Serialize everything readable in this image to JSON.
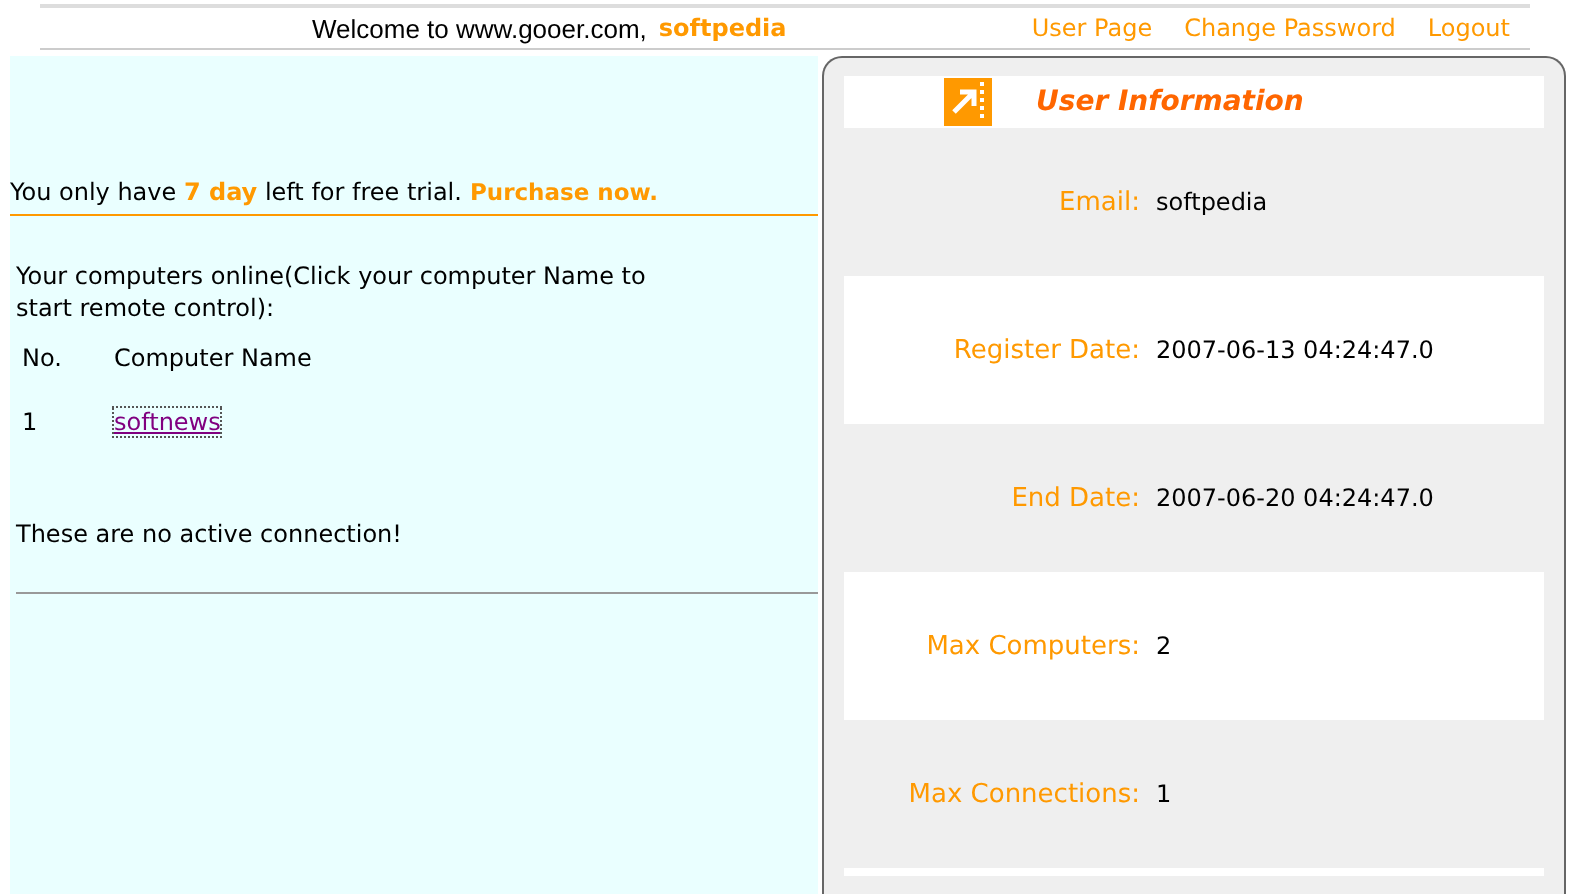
{
  "header": {
    "welcome": "Welcome to www.gooer.com,",
    "username": "softpedia",
    "links": [
      {
        "label": "User Page"
      },
      {
        "label": "Change Password"
      },
      {
        "label": "Logout"
      }
    ]
  },
  "trial": {
    "message": "You only have **7 day** left for free trial.",
    "purchase": "Purchase now."
  },
  "computers": {
    "intro": "Your computers online(Click your computer Name to start remote control):",
    "columns": [
      "No.",
      "Computer Name"
    ],
    "rows": [
      {
        "no": "1",
        "name": "softnews"
      }
    ],
    "status": "These are no active connection!"
  },
  "user_info": {
    "title": "User Information",
    "fields": [
      {
        "label": "Email:",
        "value": "softpedia"
      },
      {
        "label": "Register Date:",
        "value": "2007-06-13 04:24:47.0"
      },
      {
        "label": "End Date:",
        "value": "2007-06-20 04:24:47.0"
      },
      {
        "label": "Max Computers:",
        "value": "2"
      },
      {
        "label": "Max Connections:",
        "value": "1"
      }
    ]
  }
}
